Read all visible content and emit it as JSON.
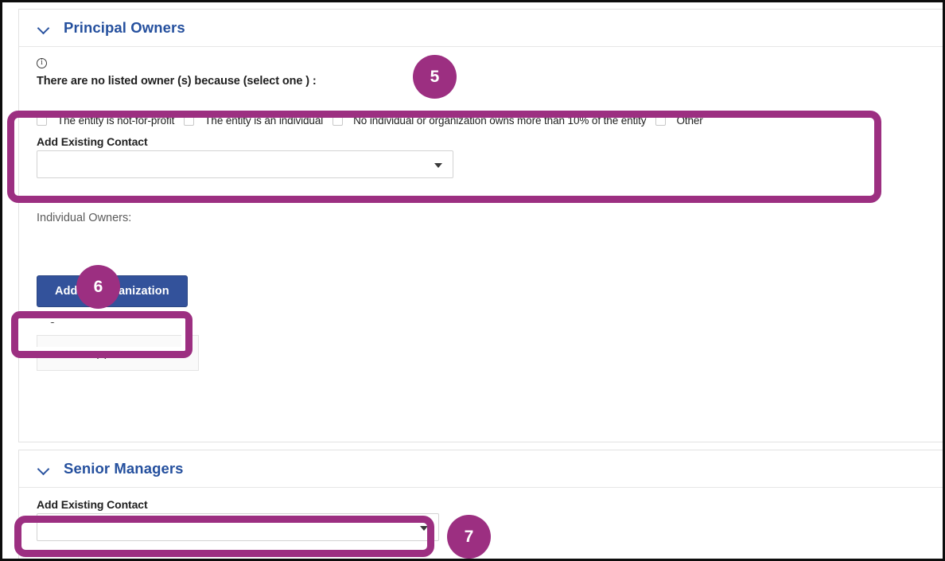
{
  "sections": [
    {
      "id": "principal-owners",
      "title": "Principal Owners",
      "info_text": "There are no listed owner (s) because (select one ) :",
      "checkboxes": [
        {
          "label": "The entity is not-for-profit",
          "checked": false
        },
        {
          "label": "The entity is an individual",
          "checked": false
        },
        {
          "label": "No individual or organization owns more than 10% of the entity",
          "checked": false
        },
        {
          "label": "Other",
          "checked": false
        }
      ],
      "contact_field": {
        "label": "Add Existing Contact",
        "value": "",
        "placeholder": ""
      },
      "individual_owners_label": "Individual Owners:",
      "add_organization_button": "Add an Organization",
      "organization_owners_label": "Organization Owners",
      "organization_owners_results": "0 Result(s)"
    },
    {
      "id": "senior-managers",
      "title": "Senior Managers",
      "contact_field": {
        "label": "Add Existing Contact",
        "value": "",
        "placeholder": ""
      }
    }
  ],
  "annotations": [
    {
      "number": "5",
      "target": "principal-owners-checkbox-and-contact-group"
    },
    {
      "number": "6",
      "target": "add-an-organization-button"
    },
    {
      "number": "7",
      "target": "senior-managers-contact-dropdown"
    }
  ],
  "icons": {
    "collapse_chevron": "chevron-down-icon",
    "info": "info-circle-icon",
    "dropdown_caret": "caret-down-icon"
  },
  "colors": {
    "accent_magenta": "#9C2F81",
    "header_blue": "#25509E",
    "button_blue": "#33529B",
    "border_grey": "#E2E2E2",
    "text_dark": "#1F1F1F",
    "text_muted": "#5B5B5B"
  }
}
